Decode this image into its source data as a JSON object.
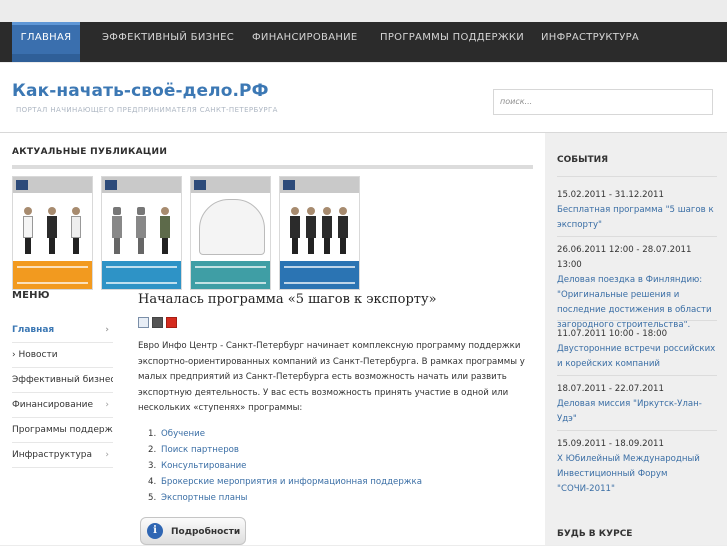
{
  "nav": {
    "items": [
      {
        "label": "ГЛАВНАЯ",
        "active": true
      },
      {
        "label": "ЭФФЕКТИВНЫЙ БИЗНЕС"
      },
      {
        "label": "ФИНАНСИРОВАНИЕ"
      },
      {
        "label": "ПРОГРАММЫ ПОДДЕРЖКИ"
      },
      {
        "label": "ИНФРАСТРУКТУРА"
      }
    ]
  },
  "header": {
    "title": "Как-начать-своё-дело.РФ",
    "subtitle": "ПОРТАЛ НАЧИНАЮЩЕГО ПРЕДПРИНИМАТЕЛЯ САНКТ-ПЕТЕРБУРГА"
  },
  "search": {
    "placeholder": "поиск..."
  },
  "publications": {
    "title": "АКТУАЛЬНЫЕ ПУБЛИКАЦИИ"
  },
  "thumbs": [
    {
      "color": "#f29a1f"
    },
    {
      "color": "#2e93c6"
    },
    {
      "color": "#3f9ea5"
    },
    {
      "color": "#2b74b3"
    }
  ],
  "menu": {
    "title": "МЕНЮ",
    "items": [
      {
        "label": "Главная",
        "active": true,
        "chevron": "›"
      },
      {
        "label": "› Новости",
        "chevron": ""
      },
      {
        "label": "Эффективный бизнес",
        "chevron": ""
      },
      {
        "label": "Финансирование",
        "chevron": "›"
      },
      {
        "label": "Программы поддержки",
        "chevron": ""
      },
      {
        "label": "Инфраструктура",
        "chevron": "›"
      }
    ]
  },
  "article": {
    "title": "Началась программа «5 шагов к экспорту»",
    "body": "Евро Инфо Центр - Санкт-Петербург начинает комплексную программу поддержки экспортно-ориентированных компаний из Санкт-Петербурга. В рамках программы у малых предприятий из Санкт-Петербурга есть возможность начать или развить экспортную деятельность. У вас есть возможность принять участие в одной или нескольких «ступенях» программы:",
    "steps": [
      {
        "num": "1.",
        "label": "Обучение"
      },
      {
        "num": "2.",
        "label": "Поиск партнеров"
      },
      {
        "num": "3.",
        "label": "Консультирование"
      },
      {
        "num": "4.",
        "label": "Брокерские мероприятия и информационная поддержка"
      },
      {
        "num": "5.",
        "label": "Экспортные планы"
      }
    ],
    "details_label": "Подробности",
    "icons": {
      "email": "email-icon",
      "print": "print-icon",
      "pdf": "pdf-icon"
    }
  },
  "events": {
    "title": "СОБЫТИЯ",
    "items": [
      {
        "date": "15.02.2011 - 31.12.2011",
        "text": "Бесплатная программа \"5 шагов к экспорту\""
      },
      {
        "date": "26.06.2011 12:00 - 28.07.2011 13:00",
        "text": "Деловая поездка в Финляндию: \"Оригинальные решения и последние достижения в области загородного строительства\"."
      },
      {
        "date": "11.07.2011 10:00 - 18:00",
        "text": "Двусторонние встречи российских и корейских компаний"
      },
      {
        "date": "18.07.2011 - 22.07.2011",
        "text": "Деловая миссия \"Иркутск-Улан-Удэ\""
      },
      {
        "date": "15.09.2011 - 18.09.2011",
        "text": "X Юбилейный Международный Инвестиционный Форум \"СОЧИ-2011\""
      }
    ]
  },
  "course": {
    "title": "БУДЬ В КУРСЕ"
  },
  "colors": {
    "accent": "#3a6fae",
    "link": "#3a6ea5",
    "nav_bg": "#2b2b2b"
  }
}
